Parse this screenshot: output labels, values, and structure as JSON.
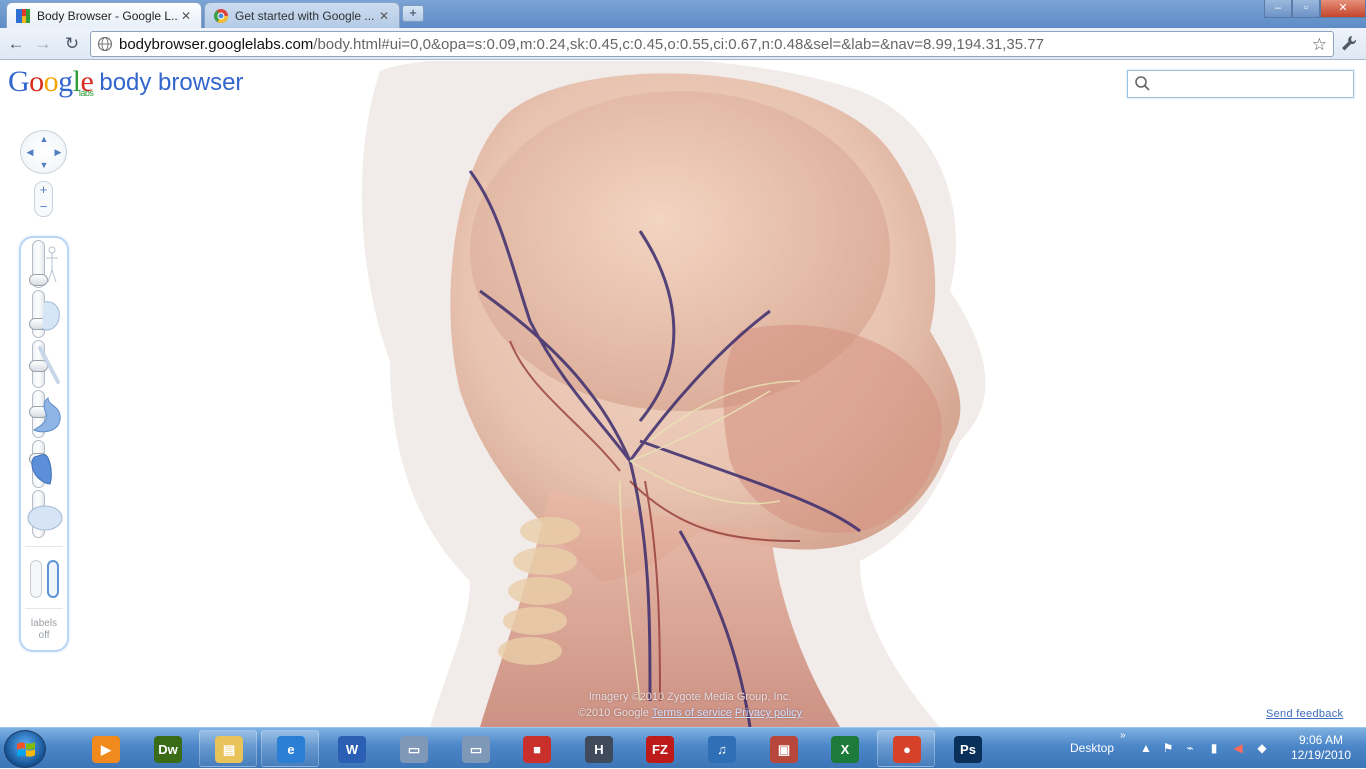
{
  "browser": {
    "tabs": [
      {
        "title": "Body Browser - Google L...",
        "close": "✕",
        "active": true
      },
      {
        "title": "Get started with Google ...",
        "close": "✕",
        "active": false
      }
    ],
    "new_tab": "+",
    "window_controls": {
      "minimize": "–",
      "maximize": "▫",
      "close": "✕"
    },
    "url_host": "bodybrowser.googlelabs.com",
    "url_path": "/body.html#ui=0,0&opa=s:0.09,m:0.24,sk:0.45,c:0.45,o:0.55,ci:0.67,n:0.48&sel=&lab=&nav=8.99,194.31,35.77",
    "back": "←",
    "forward": "→",
    "reload": "↻",
    "star": "☆",
    "wrench": "🔧"
  },
  "page": {
    "logo_text": "Google",
    "logo_labs": "labs",
    "product_name": "body browser",
    "search": {
      "placeholder": "",
      "value": ""
    },
    "nav": {
      "up": "▲",
      "down": "▼",
      "left": "◀",
      "right": "▶",
      "zoom_in": "+",
      "zoom_out": "−"
    },
    "layers_panel": {
      "layers": [
        {
          "name": "skin",
          "level": 0.0
        },
        {
          "name": "muscle",
          "level": 0.2
        },
        {
          "name": "skeleton",
          "level": 0.45
        },
        {
          "name": "organs",
          "level": 0.55
        },
        {
          "name": "circulatory",
          "level": 0.67
        },
        {
          "name": "nervous",
          "level": 0.48
        }
      ],
      "labels_text_line1": "labels",
      "labels_text_line2": "off"
    },
    "credits": {
      "imagery": "Imagery ©2010 Zygote Media Group, Inc.",
      "copyright": "©2010 Google",
      "terms": "Terms of service",
      "privacy": "Privacy policy"
    },
    "feedback": "Send feedback"
  },
  "taskbar": {
    "items": [
      {
        "name": "media-player",
        "label": "▶",
        "color": "#f08a1c",
        "open": false
      },
      {
        "name": "dreamweaver",
        "label": "Dw",
        "color": "#3a6b17",
        "open": false
      },
      {
        "name": "explorer",
        "label": "▤",
        "color": "#e8c35a",
        "open": true
      },
      {
        "name": "internet-explorer",
        "label": "e",
        "color": "#2a7fd4",
        "open": true
      },
      {
        "name": "word",
        "label": "W",
        "color": "#2b5fb4",
        "open": false
      },
      {
        "name": "window-app-1",
        "label": "▭",
        "color": "#7f98b8",
        "open": false
      },
      {
        "name": "window-app-2",
        "label": "▭",
        "color": "#7f98b8",
        "open": false
      },
      {
        "name": "red-app",
        "label": "■",
        "color": "#c9302c",
        "open": false
      },
      {
        "name": "h-app",
        "label": "H",
        "color": "#3f4a5a",
        "open": false
      },
      {
        "name": "filezilla",
        "label": "FZ",
        "color": "#bf1a1a",
        "open": false
      },
      {
        "name": "itunes",
        "label": "♫",
        "color": "#2f6fb5",
        "open": false
      },
      {
        "name": "image-app",
        "label": "▣",
        "color": "#b8473b",
        "open": false
      },
      {
        "name": "excel",
        "label": "X",
        "color": "#1d7a3b",
        "open": false
      },
      {
        "name": "chrome",
        "label": "●",
        "color": "#d6412a",
        "open": true
      },
      {
        "name": "photoshop",
        "label": "Ps",
        "color": "#0a2f59",
        "open": false
      }
    ],
    "desktop_label": "Desktop",
    "desktop_chevron": "»",
    "tray_chevron": "▲",
    "clock_time": "9:06 AM",
    "clock_date": "12/19/2010"
  }
}
